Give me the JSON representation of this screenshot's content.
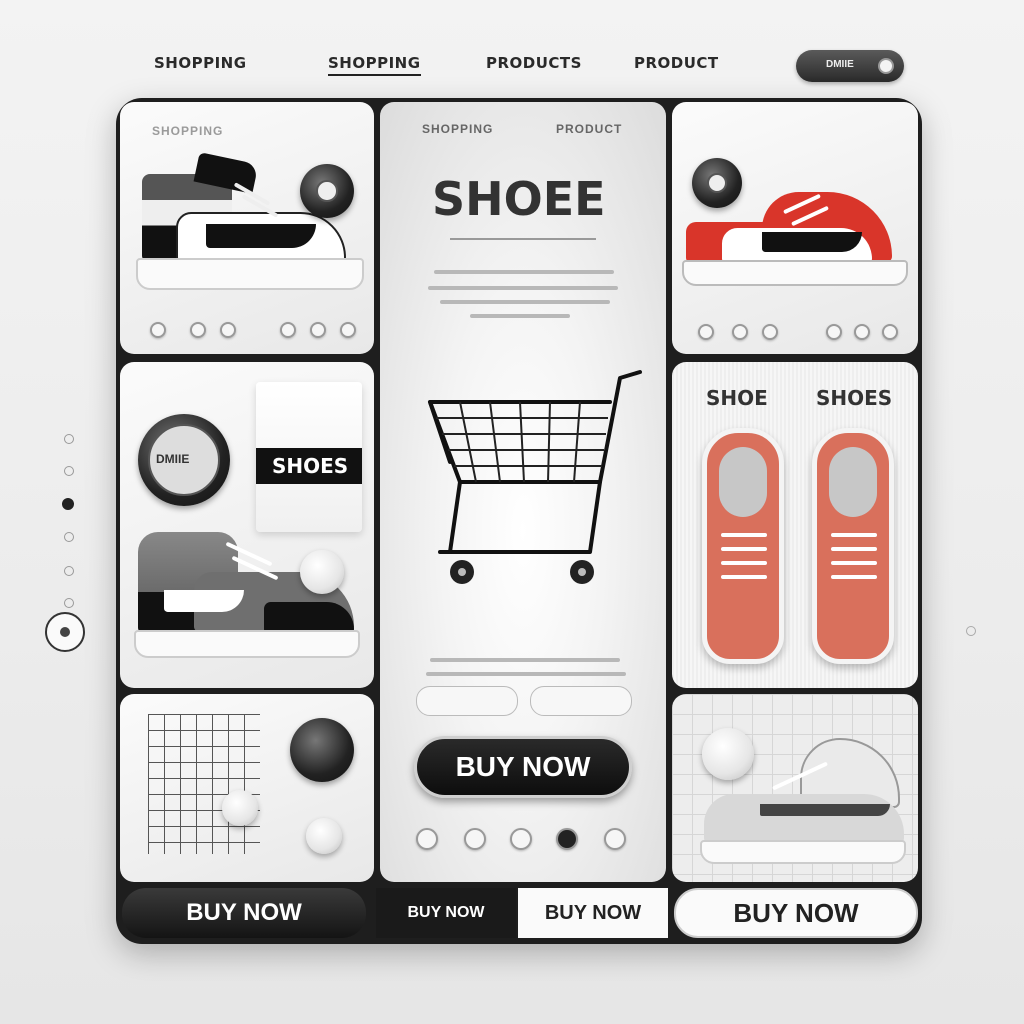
{
  "nav": {
    "items": [
      "SHOPPING",
      "SHOPPING",
      "PRODUCTS",
      "PRODUCT"
    ],
    "active_index": 1,
    "toggle_label": "DMIIE"
  },
  "panels": {
    "top_left": {
      "caption": "SHOPPING"
    },
    "center": {
      "header_left": "SHOPPING",
      "header_right": "PRODUCT",
      "title": "SHOEE",
      "primary_button": "BUY NOW"
    },
    "mid_left": {
      "badge_label": "DMIIE",
      "box_label": "SHOES"
    },
    "mid_right": {
      "label_left": "SHOE",
      "label_right": "SHOES"
    }
  },
  "bottom_buttons": [
    "BUY NOW",
    "BUY NOW",
    "BUY NOW",
    "BUY NOW"
  ],
  "colors": {
    "frame": "#1e1e1e",
    "primary_button": "#1a1a1a",
    "accent_red": "#d9352a",
    "accent_salmon": "#d9705c"
  },
  "icons": [
    "shopping-cart-icon",
    "sneaker-icon",
    "radio-button-icon"
  ]
}
